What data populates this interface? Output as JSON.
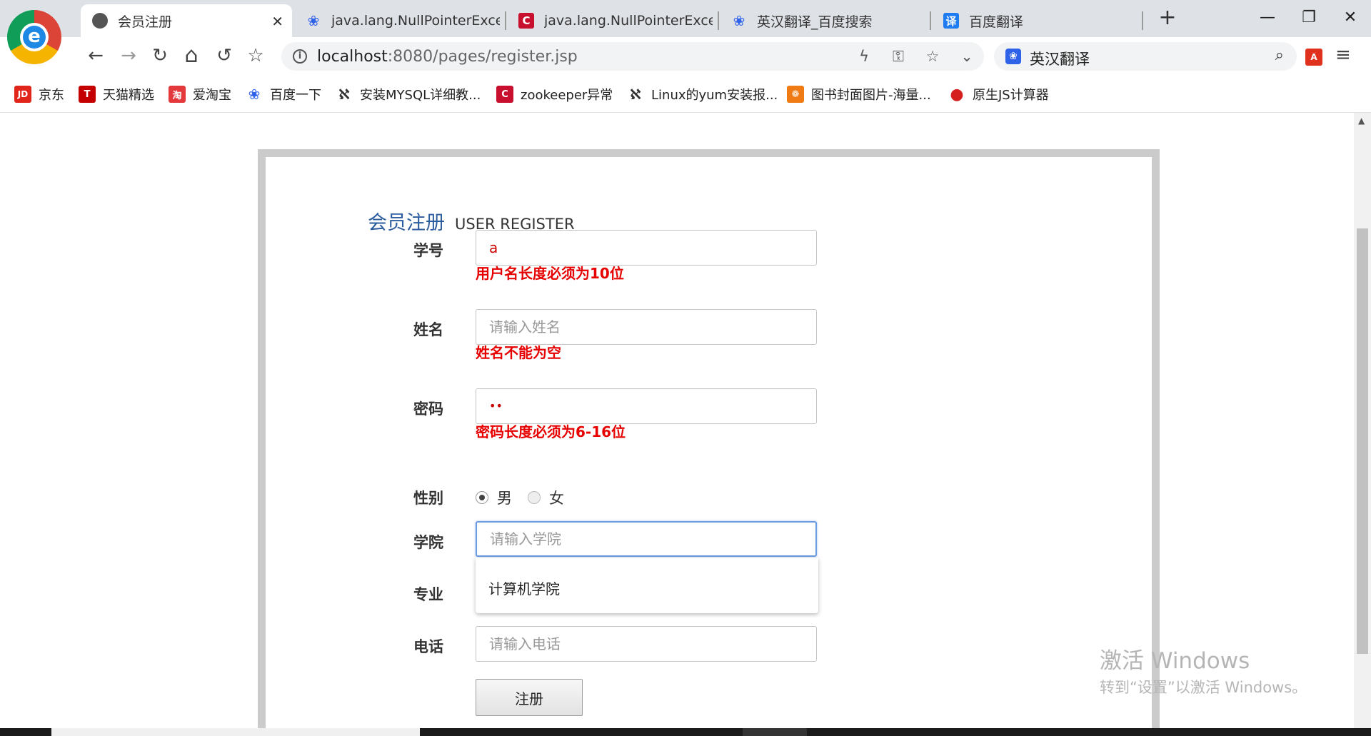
{
  "browser": {
    "tabs": [
      {
        "title": "会员注册",
        "close": "✕"
      },
      {
        "title": "java.lang.NullPointerExcep"
      },
      {
        "title": "java.lang.NullPointerExcep"
      },
      {
        "title": "英汉翻译_百度搜索"
      },
      {
        "title": "百度翻译"
      }
    ],
    "new_tab": "+",
    "window": {
      "minimize": "—",
      "restore": "❐",
      "close": "✕"
    },
    "logo_letter": "e",
    "csdn_glyph": "C",
    "fanyi_glyph": "译"
  },
  "toolbar": {
    "back": "←",
    "forward": "→",
    "reload": "↻",
    "home": "⌂",
    "undo": "↺",
    "bookmark": "☆",
    "info": "i",
    "url_host": "localhost",
    "url_rest": ":8080/pages/register.jsp",
    "flash": "ϟ",
    "key": "⚿",
    "star": "☆",
    "dropdown": "⌄",
    "search_value": "英汉翻译",
    "search_icon": "⌕",
    "pdf_glyph": "A",
    "menu": "≡"
  },
  "bookmarks": [
    {
      "label": "京东",
      "icon_text": "JD"
    },
    {
      "label": "天猫精选",
      "icon_text": "T"
    },
    {
      "label": "爱淘宝",
      "icon_text": "淘"
    },
    {
      "label": "百度一下",
      "icon_text": "❀"
    },
    {
      "label": "安装MYSQL详细教...",
      "icon_text": "ℵ"
    },
    {
      "label": "zookeeper异常",
      "icon_text": "C"
    },
    {
      "label": "Linux的yum安装报...",
      "icon_text": "ℵ"
    },
    {
      "label": "图书封面图片-海量...",
      "icon_text": "❁"
    },
    {
      "label": "原生JS计算器",
      "icon_text": "●"
    }
  ],
  "form": {
    "title_cn": "会员注册",
    "title_en": "USER REGISTER",
    "student_id": {
      "label": "学号",
      "value": "a",
      "error": "用户名长度必须为10位"
    },
    "name": {
      "label": "姓名",
      "placeholder": "请输入姓名",
      "error": "姓名不能为空"
    },
    "password": {
      "label": "密码",
      "value": "••",
      "error": "密码长度必须为6-16位"
    },
    "gender": {
      "label": "性别",
      "options": [
        "男",
        "女"
      ],
      "selected": "男"
    },
    "college": {
      "label": "学院",
      "placeholder": "请输入学院",
      "suggestion": "计算机学院"
    },
    "major": {
      "label": "专业"
    },
    "phone": {
      "label": "电话",
      "placeholder": "请输入电话"
    },
    "submit_label": "注册"
  },
  "watermark": {
    "line1": "激活 Windows",
    "line2": "转到“设置”以激活 Windows。"
  },
  "colors": {
    "error": "#e60000",
    "title_blue": "#2b5d9e",
    "focus_border": "#6b9be0"
  }
}
